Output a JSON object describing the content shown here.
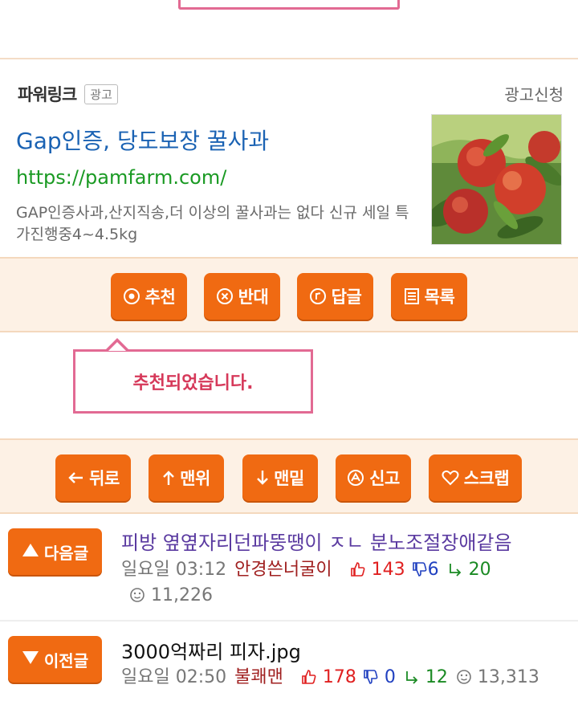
{
  "ad": {
    "label": "파워링크",
    "badge": "광고",
    "apply": "광고신청",
    "title": "Gap인증, 당도보장 꿀사과",
    "url": "https://pamfarm.com/",
    "description": "GAP인증사과,산지직송,더 이상의 꿀사과는 없다 신규 세일 특가진행중4~4.5kg"
  },
  "actions": {
    "recommend": "추천",
    "oppose": "반대",
    "reply": "답글",
    "list": "목록"
  },
  "notice": "추천되었습니다.",
  "nav_actions": {
    "back": "뒤로",
    "top": "맨위",
    "bottom": "맨밑",
    "report": "신고",
    "scrap": "스크랩"
  },
  "next_post": {
    "button": "다음글",
    "title": "피방 옆옆자리던파뚱땡이 ㅈㄴ 분노조절장애같음",
    "time": "일요일 03:12",
    "author": "안경쓴너굴이",
    "upvotes": "143",
    "downvotes": "6",
    "replies": "20",
    "views": "11,226"
  },
  "prev_post": {
    "button": "이전글",
    "title": "3000억짜리 피자.jpg",
    "time": "일요일 02:50",
    "author": "불쾌맨",
    "upvotes": "178",
    "downvotes": "0",
    "replies": "12",
    "views": "13,313"
  },
  "colors": {
    "accent": "#f06a12",
    "notice_border": "#e26a93",
    "link_blue": "#1a62b3",
    "url_green": "#1a9a23"
  }
}
